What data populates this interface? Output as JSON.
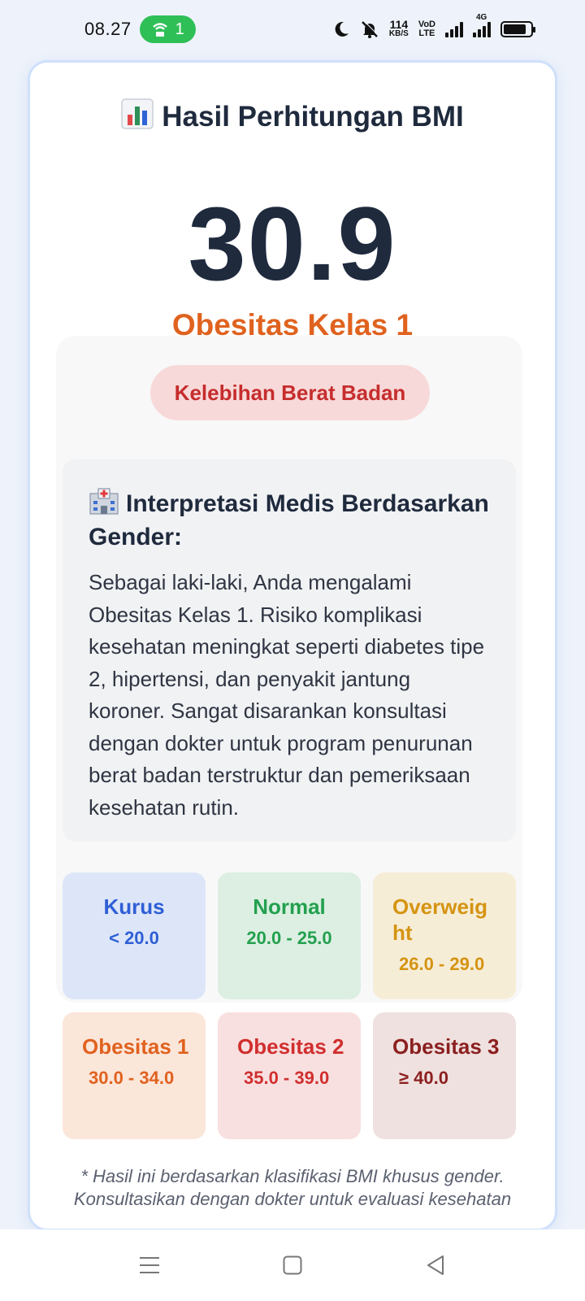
{
  "status_bar": {
    "time": "08.27",
    "hotspot_count": "1",
    "net_speed_value": "114",
    "net_speed_unit": "KB/S",
    "volte_top": "VoD",
    "volte_bottom": "LTE",
    "network_type": "4G",
    "icons": [
      "moon-icon",
      "bell-muted-icon",
      "signal-icon",
      "battery-icon"
    ]
  },
  "result": {
    "title": "Hasil Perhitungan BMI",
    "title_icon": "bar-chart-icon",
    "bmi_value": "30.9",
    "category": "Obesitas Kelas 1",
    "badge": "Kelebihan Berat Badan"
  },
  "interpretation": {
    "icon": "hospital-icon",
    "title": "Interpretasi Medis Berdasarkan Gender:",
    "body": "Sebagai laki-laki, Anda mengalami Obesitas Kelas 1. Risiko komplikasi kesehatan meningkat seperti diabetes tipe 2, hipertensi, dan penyakit jantung koroner. Sangat disarankan konsultasi dengan dokter untuk program penurunan berat badan terstruktur dan pemeriksaan kesehatan rutin."
  },
  "categories": [
    {
      "name": "Kurus",
      "range": "< 20.0",
      "bg": "#dde6f8",
      "color": "#2f5fd6"
    },
    {
      "name": "Normal",
      "range": "20.0 - 25.0",
      "bg": "#dcefe2",
      "color": "#23a04e"
    },
    {
      "name": "Overweight",
      "range": "26.0 - 29.0",
      "bg": "#f6edd7",
      "color": "#d59412"
    },
    {
      "name": "Obesitas 1",
      "range": "30.0 - 34.0",
      "bg": "#fbe6da",
      "color": "#e0621f"
    },
    {
      "name": "Obesitas 2",
      "range": "35.0 - 39.0",
      "bg": "#f8e0e0",
      "color": "#d12f2f"
    },
    {
      "name": "Obesitas 3",
      "range": "≥ 40.0",
      "bg": "#efe1df",
      "color": "#8b1f1f"
    }
  ],
  "footnote": "* Hasil ini berdasarkan klasifikasi BMI khusus gender. Konsultasikan dengan dokter untuk evaluasi kesehatan",
  "nav": [
    "menu-icon",
    "home-icon",
    "back-icon"
  ]
}
